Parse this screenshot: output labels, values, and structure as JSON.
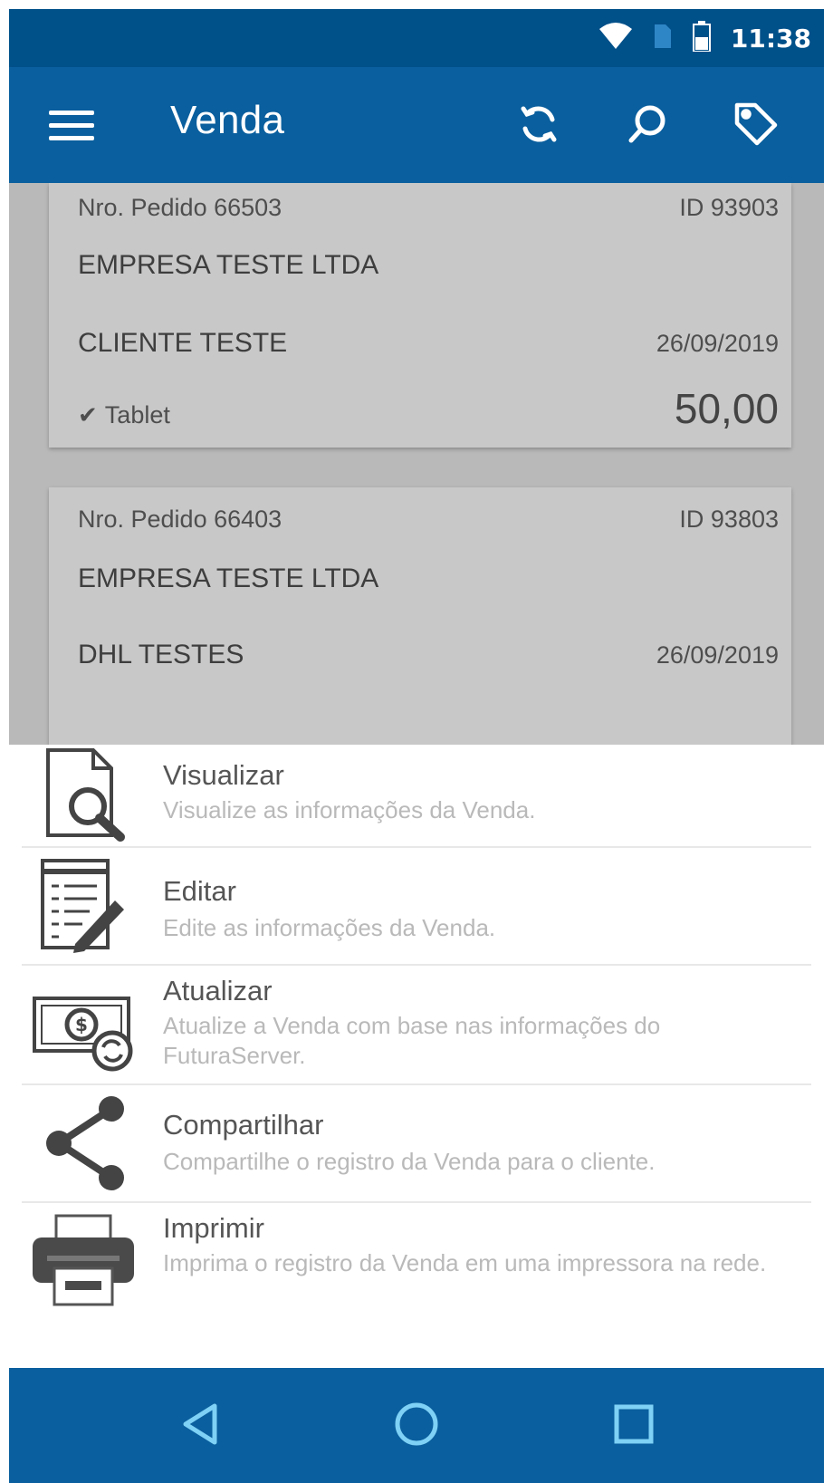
{
  "status_bar": {
    "time": "11:38",
    "icons": [
      "wifi-icon",
      "sim-icon",
      "battery-icon"
    ]
  },
  "app_bar": {
    "title": "Venda",
    "actions": [
      "sync-icon",
      "search-icon",
      "tag-icon"
    ]
  },
  "orders": [
    {
      "order_number": "Nro. Pedido 66503",
      "id": "ID 93903",
      "company": "EMPRESA TESTE LTDA",
      "client": "CLIENTE TESTE",
      "date": "26/09/2019",
      "device": "Tablet",
      "total": "50,00"
    },
    {
      "order_number": "Nro. Pedido 66403",
      "id": "ID 93803",
      "company": "EMPRESA TESTE LTDA",
      "client": "DHL TESTES",
      "date": "26/09/2019"
    }
  ],
  "actions_sheet": {
    "items": [
      {
        "title": "Visualizar",
        "description": "Visualize as informações da Venda.",
        "icon": "document-search-icon"
      },
      {
        "title": "Editar",
        "description": "Edite as informações da Venda.",
        "icon": "edit-form-icon"
      },
      {
        "title": "Atualizar",
        "description": "Atualize a Venda com base nas informações do FuturaServer.",
        "icon": "money-refresh-icon"
      },
      {
        "title": "Compartilhar",
        "description": "Compartilhe o registro da Venda para o cliente.",
        "icon": "share-icon"
      },
      {
        "title": "Imprimir",
        "description": "Imprima o registro da Venda em uma impressora na rede.",
        "icon": "printer-icon"
      }
    ]
  },
  "nav_bar": {
    "buttons": [
      "back-icon",
      "home-icon",
      "recents-icon"
    ]
  },
  "colors": {
    "status_bar": "#00508a",
    "app_bar": "#0a5f9e",
    "nav_bar": "#0a5f9e",
    "list_background": "#c9c9c9",
    "card": "#dadada"
  }
}
